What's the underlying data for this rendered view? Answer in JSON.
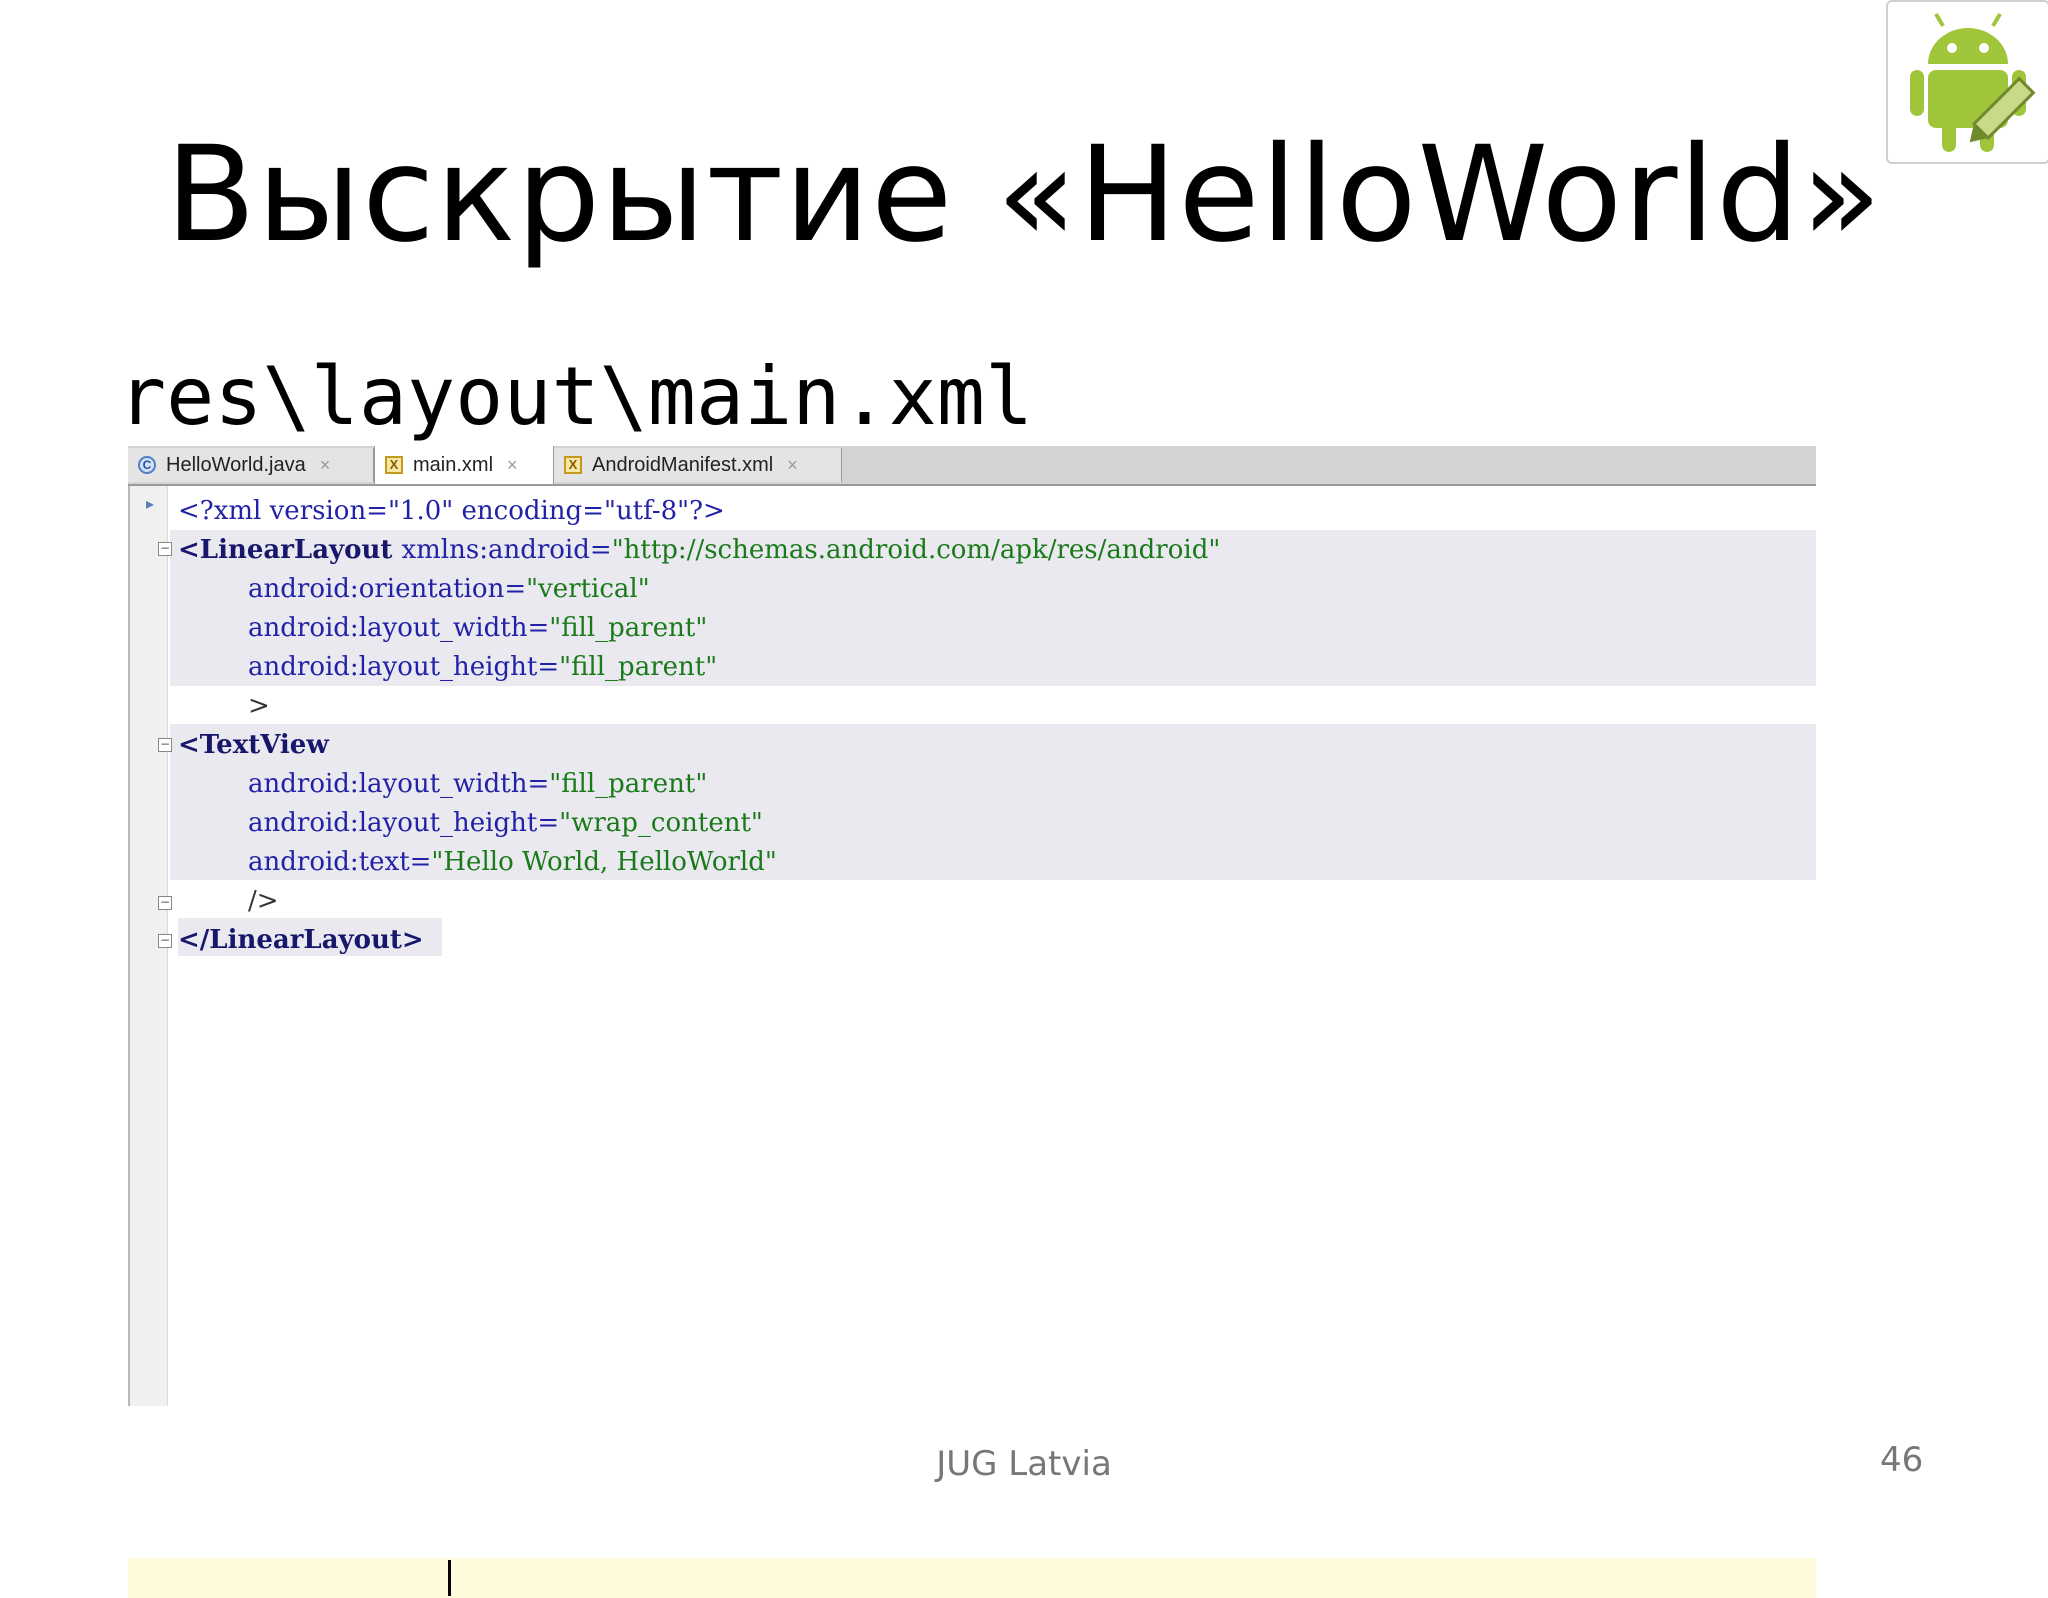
{
  "slide": {
    "title": "Выскрытие «HelloWorld»",
    "path": "res\\layout\\main.xml",
    "footer": "JUG Latvia",
    "page_number": "46"
  },
  "tabs": [
    {
      "label": "HelloWorld.java",
      "icon": "java-class-icon",
      "icon_glyph": "C"
    },
    {
      "label": "main.xml",
      "icon": "xml-file-icon",
      "icon_glyph": "X",
      "active": true
    },
    {
      "label": "AndroidManifest.xml",
      "icon": "xml-file-icon",
      "icon_glyph": "X"
    }
  ],
  "code": {
    "l1a": "<?xml version=\"1.0\" encoding=\"utf-8\"?>",
    "l2a": "<LinearLayout ",
    "l2b": "xmlns:android=",
    "l2c": "\"http://schemas.android.com/apk/res/android\"",
    "l3a": "android:orientation=",
    "l3b": "\"vertical\"",
    "l4a": "android:layout_width=",
    "l4b": "\"fill_parent\"",
    "l5a": "android:layout_height=",
    "l5b": "\"fill_parent\"",
    "l6a": ">",
    "l7a": "<TextView",
    "l8a": "android:layout_width=",
    "l8b": "\"fill_parent\"",
    "l9a": "android:layout_height=",
    "l9b": "\"wrap_content\"",
    "l10a": "android:text=",
    "l10b": "\"Hello World, HelloWorld\"",
    "l11a": "/>",
    "l12a": "</LinearLayout>"
  },
  "colors": {
    "tag": "#17176b",
    "attribute": "#2222a8",
    "value": "#1a7a1a",
    "current_line": "#fdfbd9",
    "android_green": "#9fc63b"
  }
}
